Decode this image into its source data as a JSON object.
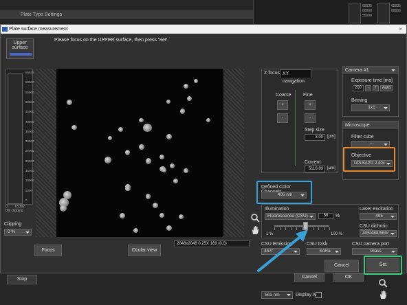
{
  "background": {
    "title": "Plate Type Settings",
    "right_numbers": [
      "65535",
      "60000",
      "55000",
      "65535",
      "60000"
    ],
    "stop_label": "Stop",
    "cancel_label": "Cancel",
    "ok_label": "OK",
    "wavelength": "561 nm",
    "display_af": "Display AF"
  },
  "dialog": {
    "title": "Plate surface measurement",
    "close": "×",
    "upper_tab": "Upper surface",
    "instruction": "Please focus on the UPPER surface, then press 'Set'."
  },
  "histogram": {
    "ticks": [
      "65535",
      "60000",
      "55000",
      "50000",
      "45000",
      "40000",
      "35000",
      "30000",
      "25000",
      "20000",
      "15000",
      "10000",
      "5000",
      "0"
    ],
    "min": "0",
    "max": "65392",
    "clip_note": "0% clipping",
    "clipping_label": "Clipping",
    "clipping_value": "0 %"
  },
  "image": {
    "info": "2048x2048 0.25X 169   (0,0)"
  },
  "buttons": {
    "focus": "Focus",
    "ocular": "Ocular view",
    "cancel": "Cancel",
    "set": "Set"
  },
  "zfocus": {
    "tab1": "Z focus",
    "tab2": "XY navigation",
    "coarse": "Coarse",
    "fine": "Fine",
    "plus": "+",
    "minus": "-",
    "step_label": "Step size",
    "step_value": "3.00",
    "step_unit": "[µm]",
    "current_label": "Current position",
    "current_value": "5116.89",
    "current_unit": "[µm]"
  },
  "camera": {
    "selector": "Camera  #1",
    "exposure_label": "Exposure time [ms]",
    "exposure_value": "200",
    "minus": "-",
    "plus": "+",
    "auto": "Auto",
    "binning_label": "Binning",
    "binning_value": "1x1"
  },
  "microscope": {
    "label": "Microscope",
    "filter_label": "Filter cube",
    "filter_value": "---",
    "objective_label": "Objective",
    "objective_value": "UPLSAPO 2.40x"
  },
  "channels": {
    "label": "Defined Color Channels",
    "value": "405 nm"
  },
  "illumination": {
    "label": "Illumination",
    "mode": "Fluorescence (CSU)",
    "percent": "56",
    "percent_unit": "%",
    "range_min": "1 %",
    "range_max": "100 %",
    "level": 0.56,
    "laser_label": "Laser excitation",
    "laser_value": "405",
    "dichroic_label": "CSU dichroic mirror",
    "dichroic_value": "405/488/560/",
    "emission_label": "CSU Emission",
    "emission_value": "447/",
    "disk_label": "CSU Disk",
    "disk_value": "SoRa",
    "port_label": "CSU camera port",
    "port_value": "Glass"
  },
  "colors": {
    "objective_highlight": "#e8892b",
    "channel_highlight": "#3aa0d8",
    "set_highlight": "#3cc87a",
    "arrow": "#3aa0d8"
  }
}
